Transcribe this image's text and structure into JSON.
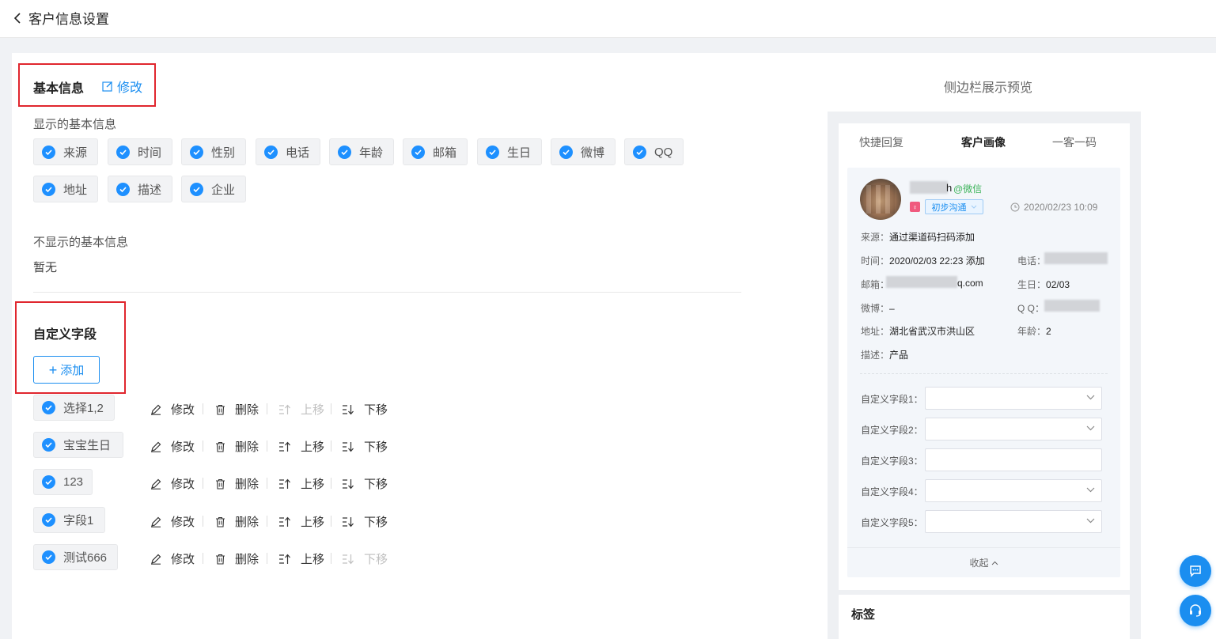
{
  "header": {
    "title": "客户信息设置"
  },
  "basic": {
    "title": "基本信息",
    "edit_label": "修改",
    "shown_label": "显示的基本信息",
    "shown_fields": [
      "来源",
      "时间",
      "性别",
      "电话",
      "年龄",
      "邮箱",
      "生日",
      "微博",
      "QQ",
      "地址",
      "描述",
      "企业"
    ],
    "hidden_label": "不显示的基本信息",
    "hidden_empty": "暂无"
  },
  "custom": {
    "title": "自定义字段",
    "add_label": "添加",
    "actions": {
      "edit": "修改",
      "delete": "删除",
      "up": "上移",
      "down": "下移"
    },
    "fields": [
      {
        "name": "选择1,2",
        "up_enabled": false,
        "down_enabled": true
      },
      {
        "name": "宝宝生日",
        "up_enabled": true,
        "down_enabled": true
      },
      {
        "name": "123",
        "up_enabled": true,
        "down_enabled": true
      },
      {
        "name": "字段1",
        "up_enabled": true,
        "down_enabled": true
      },
      {
        "name": "测试666",
        "up_enabled": true,
        "down_enabled": false
      }
    ]
  },
  "preview": {
    "title": "侧边栏展示预览",
    "tabs": [
      "快捷回复",
      "客户画像",
      "一客一码"
    ],
    "active_tab": "客户画像",
    "customer": {
      "name_suffix": "h",
      "source_tag": "@微信",
      "stage": "初步沟通",
      "added_time": "2020/02/23 10:09"
    },
    "info": {
      "source": {
        "k": "来源：",
        "v": "通过渠道码扫码添加"
      },
      "time": {
        "k": "时间：",
        "v": "2020/02/03 22:23 添加"
      },
      "phone": {
        "k": "电话：",
        "v": ""
      },
      "email": {
        "k": "邮箱：",
        "v": "q.com"
      },
      "birthday": {
        "k": "生日：",
        "v": "02/03"
      },
      "weibo": {
        "k": "微博：",
        "v": "–"
      },
      "qq": {
        "k": "Q Q：",
        "v": ""
      },
      "address": {
        "k": "地址：",
        "v": "湖北省武汉市洪山区"
      },
      "age": {
        "k": "年龄：",
        "v": "2"
      },
      "desc": {
        "k": "描述：",
        "v": "产品"
      }
    },
    "custom_fields": [
      {
        "label": "自定义字段1：",
        "type": "select"
      },
      {
        "label": "自定义字段2：",
        "type": "select"
      },
      {
        "label": "自定义字段3：",
        "type": "input"
      },
      {
        "label": "自定义字段4：",
        "type": "select"
      },
      {
        "label": "自定义字段5：",
        "type": "select"
      }
    ],
    "collapse_label": "收起",
    "tag_section_title": "标签"
  },
  "colors": {
    "accent": "#1b8ef0",
    "highlight_box": "#e0262e",
    "check": "#1e90ff"
  }
}
